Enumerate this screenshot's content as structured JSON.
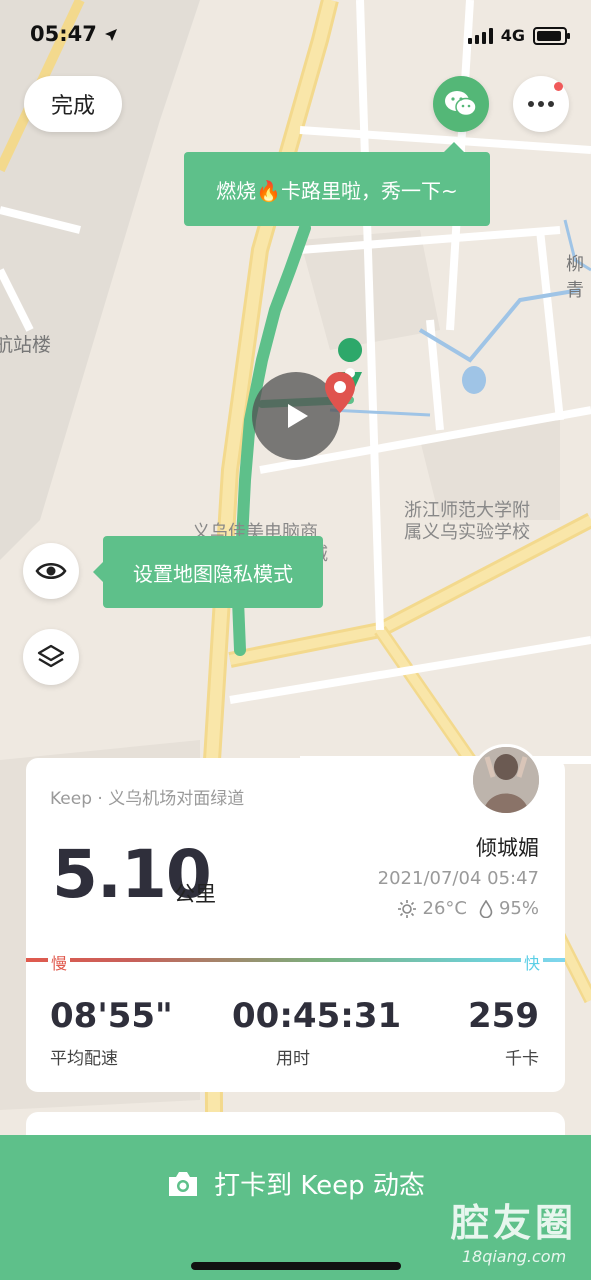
{
  "status_bar": {
    "time": "05:47",
    "network": "4G"
  },
  "header": {
    "done_label": "完成"
  },
  "map": {
    "labels": {
      "station": "航站楼",
      "school_line1": "浙江师范大学附",
      "school_line2": "属义乌实验学校",
      "mall_line1": "义乌佳美电脑商",
      "mall_line2": "城",
      "willow": "柳青"
    },
    "share_tooltip": "燃烧🔥卡路里啦，秀一下~",
    "privacy_tooltip": "设置地图隐私模式",
    "route_color": "#5ec08a",
    "end_pin_color": "#e0534e"
  },
  "summary": {
    "source": "Keep · 义乌机场对面绿道",
    "username": "倾城媚",
    "distance_value": "5.10",
    "distance_unit": "公里",
    "datetime": "2021/07/04 05:47",
    "temperature": "26°C",
    "humidity": "95%",
    "slow_label": "慢",
    "fast_label": "快",
    "stats": [
      {
        "value": "08'55\"",
        "label": "平均配速"
      },
      {
        "value": "00:45:31",
        "label": "用时"
      },
      {
        "value": "259",
        "label": "千卡"
      }
    ]
  },
  "footer": {
    "checkin_label": "打卡到 Keep 动态"
  },
  "watermark": {
    "title": "腔友圈",
    "url": "18qiang.com"
  },
  "colors": {
    "accent": "#5ec08a",
    "slow": "#e05a4e",
    "fast": "#5ccfe6"
  },
  "icons": [
    "location-arrow-icon",
    "wechat-icon",
    "more-icon",
    "eye-icon",
    "layers-icon",
    "play-icon",
    "location-pin-icon",
    "sun-icon",
    "drop-icon",
    "camera-icon"
  ]
}
